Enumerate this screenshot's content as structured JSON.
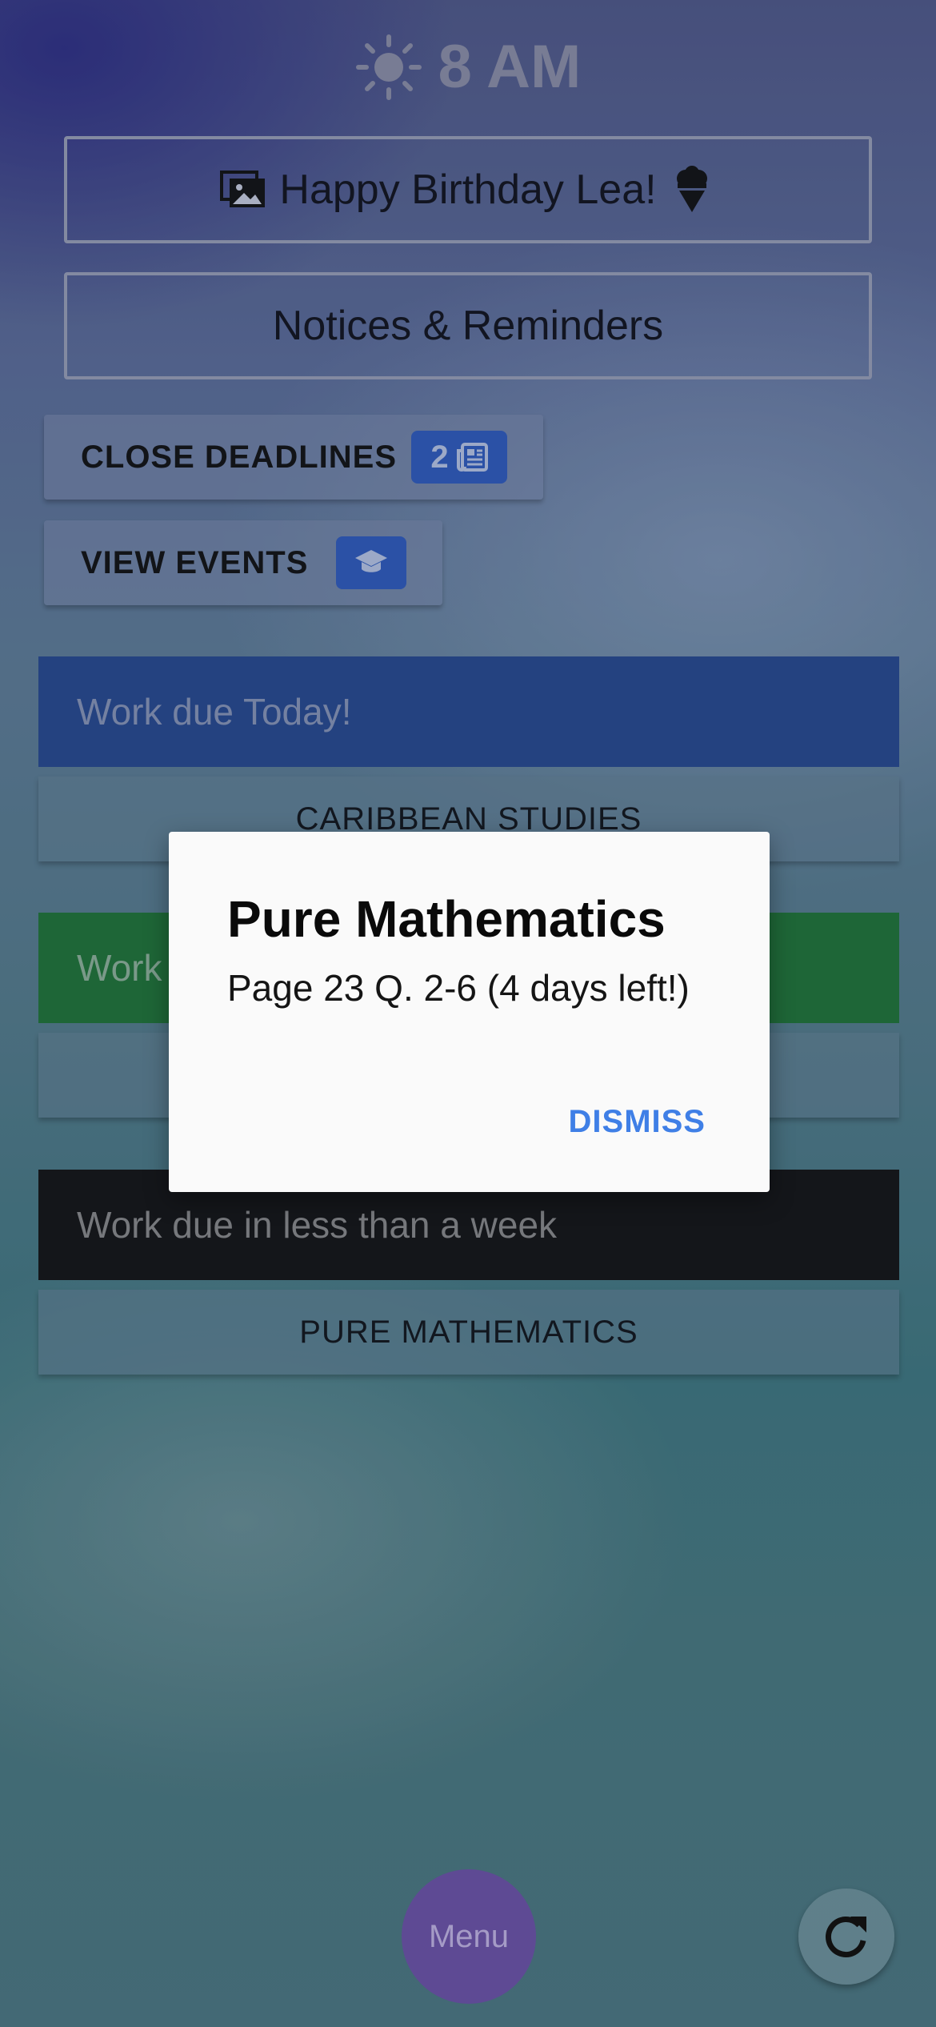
{
  "header": {
    "time": "8 AM",
    "weather_icon": "sun-icon"
  },
  "banner": {
    "text": "Happy Birthday Lea!",
    "left_icon": "photo-icon",
    "right_icon": "ice-cream-icon"
  },
  "notices": {
    "label": "Notices & Reminders"
  },
  "actions": {
    "close_deadlines": {
      "label": "CLOSE DEADLINES",
      "badge_count": "2",
      "badge_icon": "newspaper-icon"
    },
    "view_events": {
      "label": "VIEW EVENTS",
      "badge_icon": "graduation-cap-icon"
    }
  },
  "sections": {
    "today": {
      "title": "Work due Today!",
      "color": "#27488f",
      "items": [
        "CARIBBEAN STUDIES"
      ]
    },
    "green": {
      "title": "Work",
      "color": "#1f7436",
      "items": [
        ""
      ]
    },
    "week": {
      "title": "Work due in less than a week",
      "color": "#131313",
      "items": [
        "PURE MATHEMATICS"
      ]
    }
  },
  "dialog": {
    "title": "Pure Mathematics",
    "body": "Page 23 Q. 2-6 (4 days left!)",
    "dismiss_label": "DISMISS",
    "accent": "#3f7fe6"
  },
  "bottom": {
    "menu_label": "Menu",
    "menu_color": "#5e4a94",
    "refresh_icon": "refresh-icon"
  }
}
